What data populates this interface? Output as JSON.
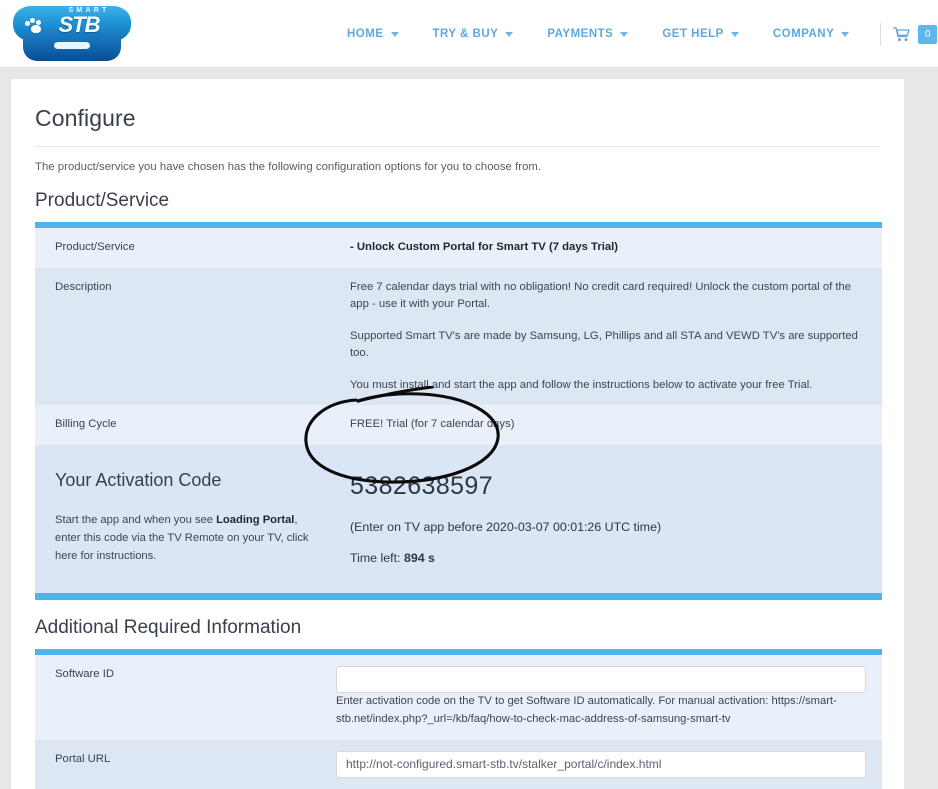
{
  "header": {
    "logo": {
      "top_text": "SMART",
      "main_text": "STB",
      "icon": "paw-print-icon"
    },
    "nav": [
      {
        "label": "HOME",
        "has_dropdown": true
      },
      {
        "label": "TRY & BUY",
        "has_dropdown": true
      },
      {
        "label": "PAYMENTS",
        "has_dropdown": true
      },
      {
        "label": "GET HELP",
        "has_dropdown": true
      },
      {
        "label": "COMPANY",
        "has_dropdown": true
      }
    ],
    "cart": {
      "icon": "shopping-cart-icon",
      "count": "0"
    }
  },
  "page": {
    "title": "Configure",
    "intro": "The product/service you have chosen has the following configuration options for you to choose from."
  },
  "product_section": {
    "title": "Product/Service",
    "rows": [
      {
        "label": "Product/Service",
        "value_bold": "- Unlock Custom Portal for Smart TV (7 days Trial)"
      },
      {
        "label": "Description",
        "paragraphs": [
          "Free 7 calendar days trial with no obligation! No credit card required! Unlock the custom portal of the app - use it with your Portal.",
          "Supported Smart TV's are made by Samsung, LG, Phillips and all STA and VEWD TV's are supported too.",
          "You must install and start the app and follow the instructions below to activate your free Trial."
        ]
      },
      {
        "label": "Billing Cycle",
        "value": "FREE! Trial (for 7 calendar days)"
      }
    ]
  },
  "activation": {
    "title": "Your Activation Code",
    "desc_part1": "Start the app and when you see ",
    "desc_bold": "Loading Portal",
    "desc_part2": ", enter this code via the TV Remote on your TV, click here for instructions.",
    "code": "5382638597",
    "deadline": "(Enter on TV app before 2020-03-07 00:01:26 UTC time)",
    "time_left_label": "Time left: ",
    "time_left_value": "894 s"
  },
  "additional_section": {
    "title": "Additional Required Information",
    "rows": [
      {
        "label": "Software ID",
        "input_value": "",
        "input_placeholder": "",
        "help": "Enter activation code on the TV to get Software ID automatically. For manual activation: https://smart-stb.net/index.php?_url=/kb/faq/how-to-check-mac-address-of-samsung-smart-tv"
      },
      {
        "label": "Portal URL",
        "input_value": "http://not-configured.smart-stb.tv/stalker_portal/c/index.html",
        "input_placeholder": ""
      }
    ]
  },
  "annotation": {
    "type": "hand-drawn-ellipse",
    "color": "#000000",
    "target": "activation code"
  },
  "colors": {
    "accent_blue": "#4fb3ec",
    "nav_blue": "#5fa8dc",
    "row_light": "#e9f0f9",
    "row_dark": "#dde7f4"
  }
}
